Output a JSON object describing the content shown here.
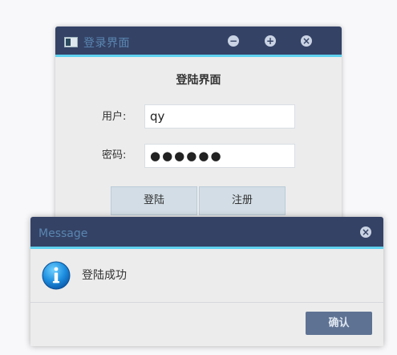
{
  "login_window": {
    "title": "登录界面",
    "heading": "登陆界面",
    "controls": {
      "minimize": "−",
      "maximize": "+",
      "close": "×"
    },
    "user_label": "用户:",
    "user_value": "qy",
    "password_label": "密码:",
    "password_value": "●●●●●●",
    "signin_label": "登陆",
    "register_label": "注册"
  },
  "message_dialog": {
    "title": "Message",
    "close": "×",
    "icon": "info-icon",
    "text": "登陆成功",
    "confirm_label": "确认"
  },
  "colors": {
    "titlebar": "#344266",
    "titlebar_accent": "#5fd2f0",
    "title_text": "#5a86b0",
    "confirm_button": "#5e7293"
  }
}
